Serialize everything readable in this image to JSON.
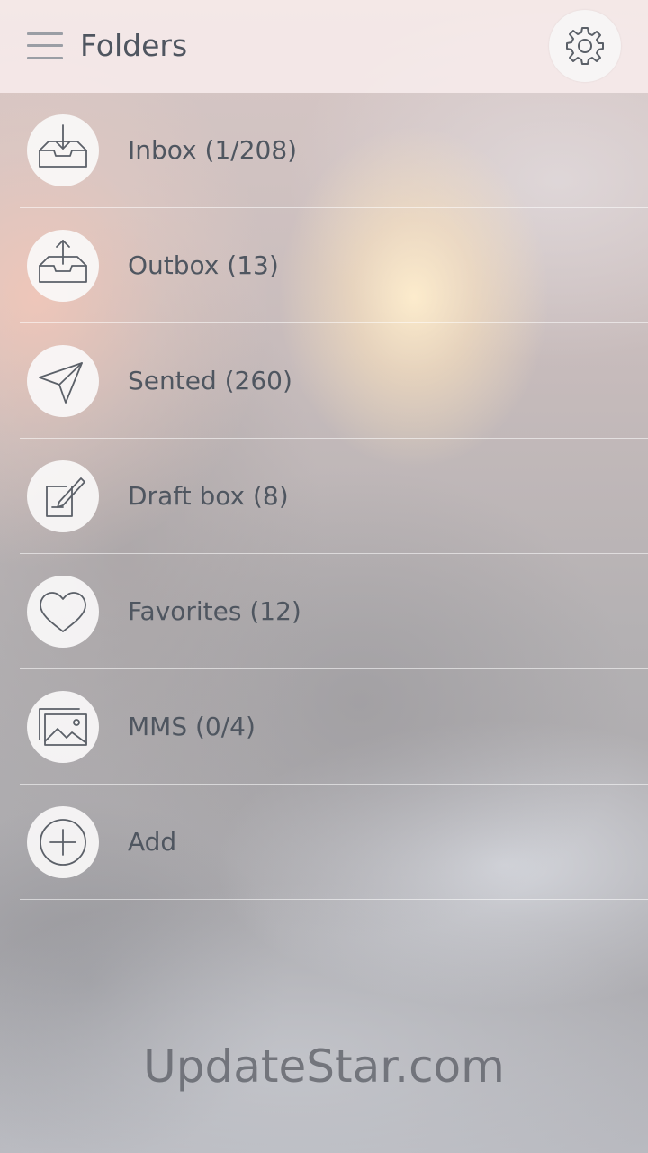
{
  "header": {
    "title": "Folders",
    "menu_icon": "hamburger-menu-icon",
    "settings_icon": "gear-icon"
  },
  "folders": [
    {
      "label": "Inbox (1/208)",
      "icon": "inbox-download-icon"
    },
    {
      "label": "Outbox (13)",
      "icon": "outbox-upload-icon"
    },
    {
      "label": "Sented (260)",
      "icon": "paper-plane-icon"
    },
    {
      "label": "Draft box (8)",
      "icon": "compose-edit-icon"
    },
    {
      "label": "Favorites (12)",
      "icon": "heart-icon"
    },
    {
      "label": "MMS (0/4)",
      "icon": "images-icon"
    },
    {
      "label": "Add",
      "icon": "plus-circle-icon"
    }
  ],
  "watermark": "UpdateStar.com",
  "colors": {
    "text": "#4f5660",
    "icon_stroke": "#5b6068",
    "header_bg": "#f7ecec",
    "circle_bg": "#faf8f8"
  }
}
